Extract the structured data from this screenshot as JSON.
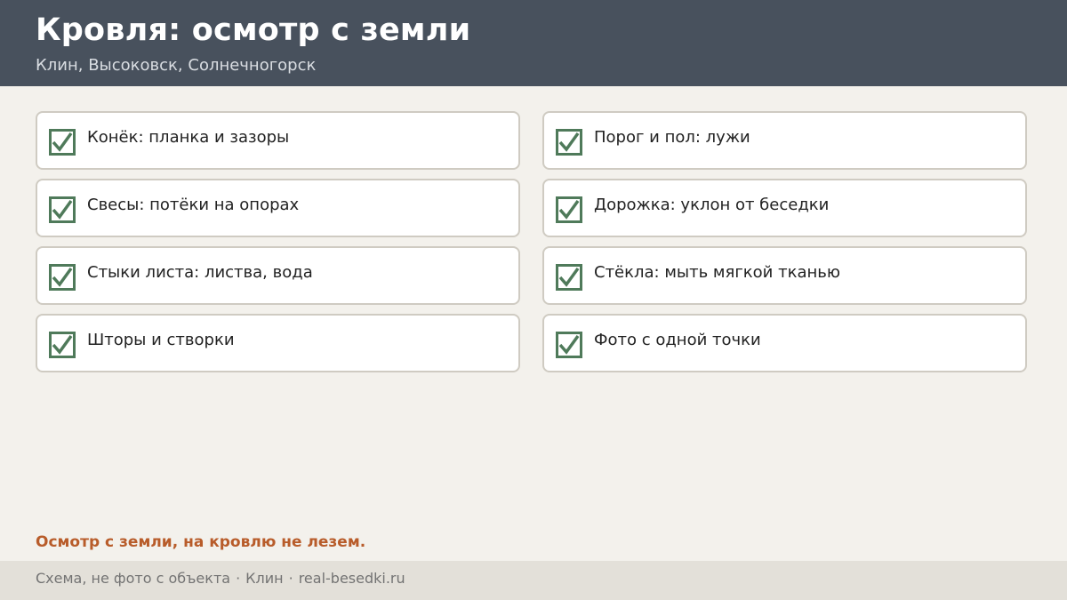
{
  "header": {
    "title": "Кровля: осмотр с земли",
    "subtitle": "Клин, Высоковск, Солнечногорск"
  },
  "checklist": {
    "items": [
      {
        "label": "Конёк: планка и зазоры",
        "checked": true
      },
      {
        "label": "Порог и пол: лужи",
        "checked": true
      },
      {
        "label": "Свесы: потёки на опорах",
        "checked": true
      },
      {
        "label": "Дорожка: уклон от беседки",
        "checked": true
      },
      {
        "label": "Стыки листа: листва, вода",
        "checked": true
      },
      {
        "label": "Стёкла: мыть мягкой тканью",
        "checked": true
      },
      {
        "label": "Шторы и створки",
        "checked": true
      },
      {
        "label": "Фото с одной точки",
        "checked": true
      }
    ]
  },
  "note": "Осмотр с земли, на кровлю не лезем.",
  "footer": {
    "part1": "Схема, не фото с объекта",
    "separator": "·",
    "part2": "Клин",
    "part3": "real-besedki.ru"
  },
  "colors": {
    "header_bg": "#48515d",
    "check_green": "#4f7a5a",
    "note_accent": "#b85c2a"
  }
}
